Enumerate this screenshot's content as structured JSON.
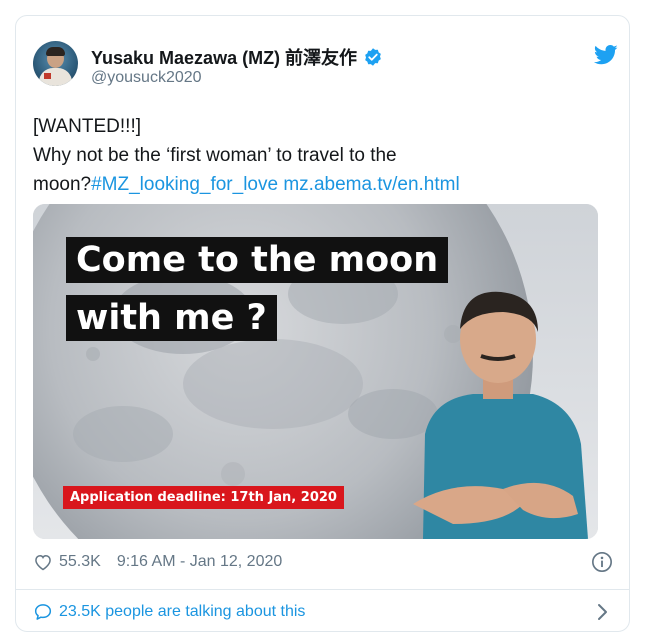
{
  "author": {
    "display_name": "Yusaku Maezawa (MZ) 前澤友作",
    "handle": "@yousuck2020",
    "avatar_icon": "astronaut-avatar",
    "verified_icon": "verified-badge-icon"
  },
  "tweet": {
    "line1": "[WANTED!!!]",
    "line2": "Why not be the ‘first woman’ to travel to the",
    "line3_text": "moon?",
    "hashtag": "#MZ_looking_for_love",
    "link": "mz.abema.tv/en.html"
  },
  "media": {
    "headline_line1": "Come to the moon",
    "headline_line2": "with me ?",
    "deadline": "Application deadline: 17th Jan, 2020"
  },
  "meta": {
    "likes": "55.3K",
    "timestamp": "9:16 AM - Jan 12, 2020"
  },
  "engagement": {
    "talking": "23.5K people are talking about this"
  },
  "colors": {
    "link_blue": "#1b95e0",
    "secondary_gray": "#657786",
    "deadline_red": "#d9161c",
    "twitter_blue": "#1da1f2"
  }
}
